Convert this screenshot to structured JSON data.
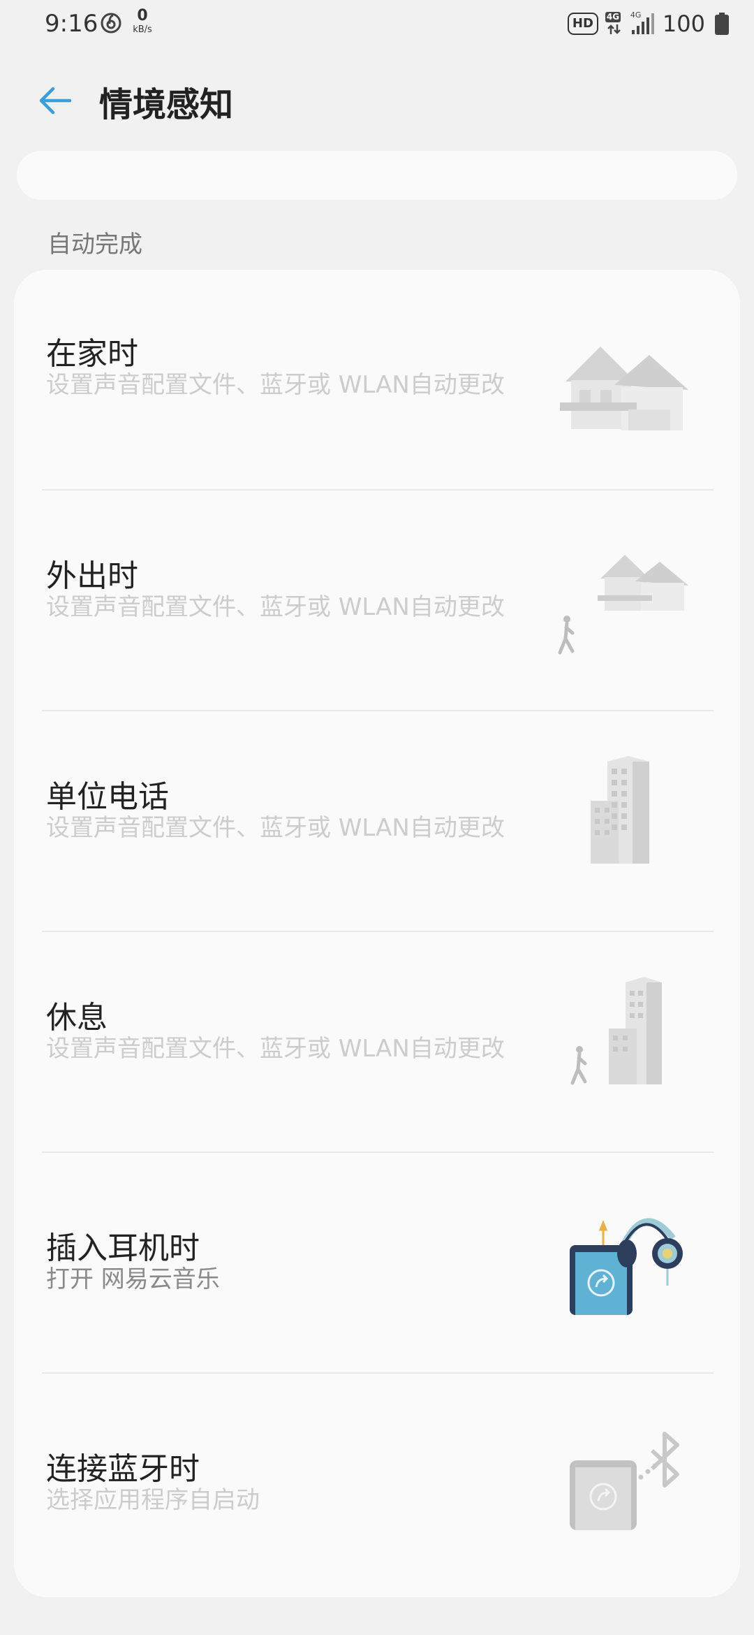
{
  "status_bar": {
    "time": "9:16",
    "speed_value": "0",
    "speed_unit": "kB/s",
    "hd": "HD",
    "network_1": "4G",
    "network_2": "4G",
    "battery": "100"
  },
  "appbar": {
    "title": "情境感知"
  },
  "section": {
    "header": "自动完成"
  },
  "items": [
    {
      "title": "在家时",
      "subtitle": "设置声音配置文件、蓝牙或 WLAN自动更改",
      "illustration": "house-icon"
    },
    {
      "title": "外出时",
      "subtitle": "设置声音配置文件、蓝牙或 WLAN自动更改",
      "illustration": "walking-away-from-house-icon"
    },
    {
      "title": "单位电话",
      "subtitle": "设置声音配置文件、蓝牙或 WLAN自动更改",
      "illustration": "office-building-icon"
    },
    {
      "title": "休息",
      "subtitle": "设置声音配置文件、蓝牙或 WLAN自动更改",
      "illustration": "walking-from-building-icon"
    },
    {
      "title": "插入耳机时",
      "subtitle": "打开 网易云音乐",
      "illustration": "headphones-phone-icon"
    },
    {
      "title": "连接蓝牙时",
      "subtitle": "选择应用程序自启动",
      "illustration": "bluetooth-phone-icon"
    }
  ],
  "colors": {
    "accent": "#3a9fd8",
    "background": "#f1f1f1",
    "card": "#fafafa",
    "subtitle_disabled": "#cccccc",
    "subtitle_active": "#8a8a8a"
  }
}
